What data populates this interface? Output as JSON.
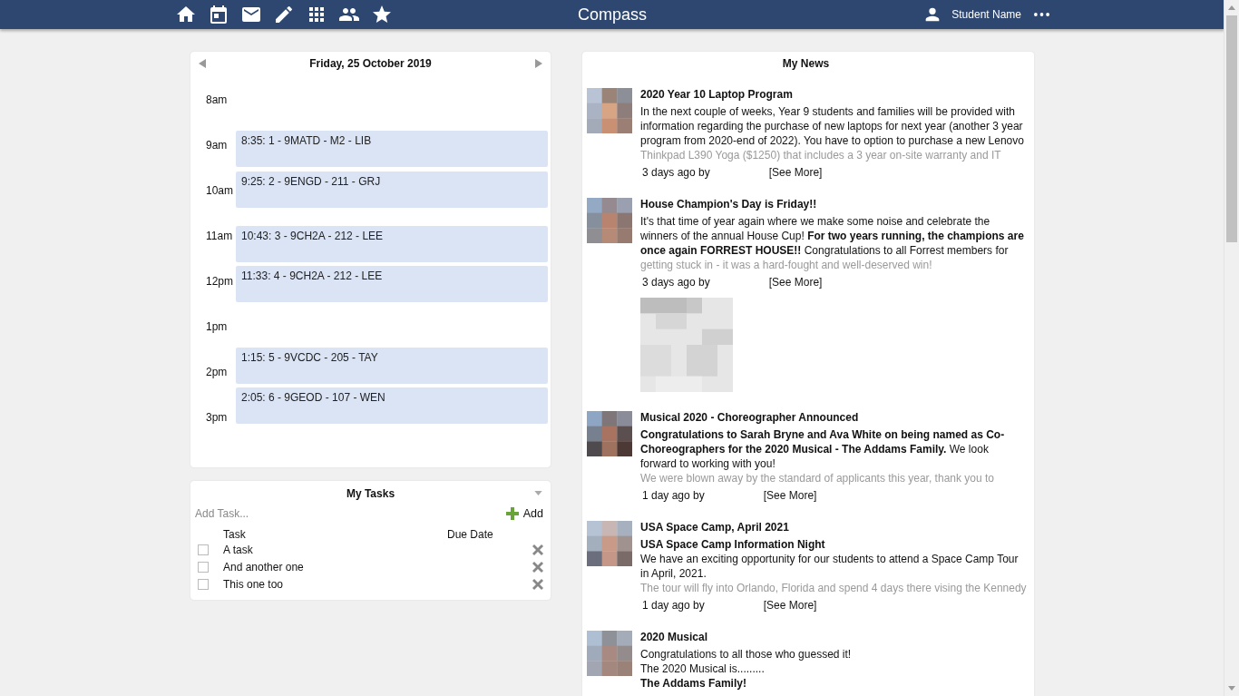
{
  "header": {
    "title": "Compass",
    "user_name": "Student Name"
  },
  "calendar": {
    "date": "Friday, 25 October 2019",
    "hours": [
      "8am",
      "9am",
      "10am",
      "11am",
      "12pm",
      "1pm",
      "2pm",
      "3pm"
    ],
    "events": [
      {
        "label": "8:35: 1 - 9MATD - M2 - LIB"
      },
      {
        "label": "9:25: 2 - 9ENGD - 211 - GRJ"
      },
      {
        "label": "10:43: 3 - 9CH2A - 212 - LEE"
      },
      {
        "label": "11:33: 4 - 9CH2A - 212 - LEE"
      },
      {
        "label": "1:15: 5 - 9VCDC - 205 - TAY"
      },
      {
        "label": "2:05: 6 - 9GEOD - 107 - WEN"
      }
    ]
  },
  "tasks": {
    "title": "My Tasks",
    "placeholder": "Add Task...",
    "add_label": "Add",
    "columns": [
      "Task",
      "Due Date"
    ],
    "rows": [
      {
        "name": "A task",
        "checked": false
      },
      {
        "name": "And another one",
        "checked": false
      },
      {
        "name": "This one too",
        "checked": false
      }
    ]
  },
  "news": {
    "title": "My News",
    "items": [
      {
        "title": "2020 Year 10 Laptop Program",
        "paragraphs": [
          "In the next couple of weeks, Year 9 students and families will be provided with information regarding the purchase of new laptops for next year (another 3 year program from 2020-end of 2022). You have to option to purchase a new Lenovo"
        ],
        "faded_line": "Thinkpad L390 Yoga  ($1250) that includes a 3 year on-site warranty and IT",
        "posted": "3 days ago by",
        "see_more": "[See More]"
      },
      {
        "title": "House Champion's Day is Friday!!",
        "paragraphs": [
          "It's that time of year again where we make some noise and celebrate the winners of the annual House Cup! **For two years running, the champions are once again FORREST HOUSE!!** Congratulations to all Forrest members for"
        ],
        "faded_line": "getting stuck in - it was a hard-fought and well-deserved win!",
        "posted": "3 days ago by",
        "see_more": "[See More]",
        "attachment": {
          "kind": "picture"
        }
      },
      {
        "title": "Musical 2020 - Choreographer Announced",
        "paragraphs": [
          "**Congratulations to Sarah Bryne and Ava White on being named as Co-Choreographers for the 2020 Musical - The Addams Family.** We look forward to working with you!"
        ],
        "faded_line": "We were blown away by the standard of applicants this year, thank you to",
        "posted": "1 day ago by",
        "see_more": "[See More]"
      },
      {
        "title": "USA Space Camp, April 2021",
        "subtitle": "USA Space Camp Information Night",
        "paragraphs": [
          "We have an exciting opportunity for our students to attend a Space Camp Tour in April, 2021."
        ],
        "faded_line": "The tour will fly into Orlando, Florida and spend 4 days there vising the Kennedy",
        "posted": "1 day ago by",
        "see_more": "[See More]"
      },
      {
        "title": "2020 Musical",
        "paragraphs": [
          "Congratulations to all those who guessed it!",
          "The 2020 Musical is........."
        ],
        "closing": "The Addams Family!"
      }
    ]
  }
}
